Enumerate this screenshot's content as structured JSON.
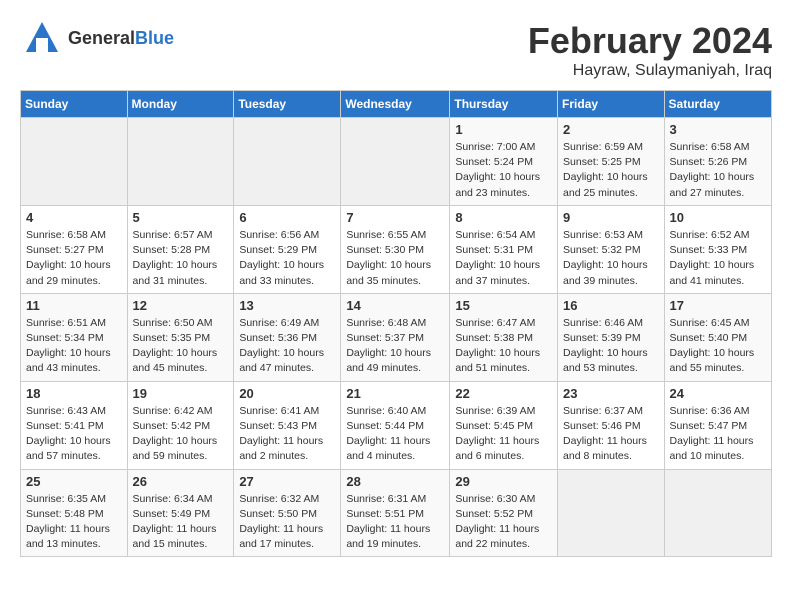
{
  "logo": {
    "general": "General",
    "blue": "Blue"
  },
  "title": "February 2024",
  "subtitle": "Hayraw, Sulaymaniyah, Iraq",
  "days_of_week": [
    "Sunday",
    "Monday",
    "Tuesday",
    "Wednesday",
    "Thursday",
    "Friday",
    "Saturday"
  ],
  "weeks": [
    [
      {
        "day": "",
        "detail": ""
      },
      {
        "day": "",
        "detail": ""
      },
      {
        "day": "",
        "detail": ""
      },
      {
        "day": "",
        "detail": ""
      },
      {
        "day": "1",
        "detail": "Sunrise: 7:00 AM\nSunset: 5:24 PM\nDaylight: 10 hours\nand 23 minutes."
      },
      {
        "day": "2",
        "detail": "Sunrise: 6:59 AM\nSunset: 5:25 PM\nDaylight: 10 hours\nand 25 minutes."
      },
      {
        "day": "3",
        "detail": "Sunrise: 6:58 AM\nSunset: 5:26 PM\nDaylight: 10 hours\nand 27 minutes."
      }
    ],
    [
      {
        "day": "4",
        "detail": "Sunrise: 6:58 AM\nSunset: 5:27 PM\nDaylight: 10 hours\nand 29 minutes."
      },
      {
        "day": "5",
        "detail": "Sunrise: 6:57 AM\nSunset: 5:28 PM\nDaylight: 10 hours\nand 31 minutes."
      },
      {
        "day": "6",
        "detail": "Sunrise: 6:56 AM\nSunset: 5:29 PM\nDaylight: 10 hours\nand 33 minutes."
      },
      {
        "day": "7",
        "detail": "Sunrise: 6:55 AM\nSunset: 5:30 PM\nDaylight: 10 hours\nand 35 minutes."
      },
      {
        "day": "8",
        "detail": "Sunrise: 6:54 AM\nSunset: 5:31 PM\nDaylight: 10 hours\nand 37 minutes."
      },
      {
        "day": "9",
        "detail": "Sunrise: 6:53 AM\nSunset: 5:32 PM\nDaylight: 10 hours\nand 39 minutes."
      },
      {
        "day": "10",
        "detail": "Sunrise: 6:52 AM\nSunset: 5:33 PM\nDaylight: 10 hours\nand 41 minutes."
      }
    ],
    [
      {
        "day": "11",
        "detail": "Sunrise: 6:51 AM\nSunset: 5:34 PM\nDaylight: 10 hours\nand 43 minutes."
      },
      {
        "day": "12",
        "detail": "Sunrise: 6:50 AM\nSunset: 5:35 PM\nDaylight: 10 hours\nand 45 minutes."
      },
      {
        "day": "13",
        "detail": "Sunrise: 6:49 AM\nSunset: 5:36 PM\nDaylight: 10 hours\nand 47 minutes."
      },
      {
        "day": "14",
        "detail": "Sunrise: 6:48 AM\nSunset: 5:37 PM\nDaylight: 10 hours\nand 49 minutes."
      },
      {
        "day": "15",
        "detail": "Sunrise: 6:47 AM\nSunset: 5:38 PM\nDaylight: 10 hours\nand 51 minutes."
      },
      {
        "day": "16",
        "detail": "Sunrise: 6:46 AM\nSunset: 5:39 PM\nDaylight: 10 hours\nand 53 minutes."
      },
      {
        "day": "17",
        "detail": "Sunrise: 6:45 AM\nSunset: 5:40 PM\nDaylight: 10 hours\nand 55 minutes."
      }
    ],
    [
      {
        "day": "18",
        "detail": "Sunrise: 6:43 AM\nSunset: 5:41 PM\nDaylight: 10 hours\nand 57 minutes."
      },
      {
        "day": "19",
        "detail": "Sunrise: 6:42 AM\nSunset: 5:42 PM\nDaylight: 10 hours\nand 59 minutes."
      },
      {
        "day": "20",
        "detail": "Sunrise: 6:41 AM\nSunset: 5:43 PM\nDaylight: 11 hours\nand 2 minutes."
      },
      {
        "day": "21",
        "detail": "Sunrise: 6:40 AM\nSunset: 5:44 PM\nDaylight: 11 hours\nand 4 minutes."
      },
      {
        "day": "22",
        "detail": "Sunrise: 6:39 AM\nSunset: 5:45 PM\nDaylight: 11 hours\nand 6 minutes."
      },
      {
        "day": "23",
        "detail": "Sunrise: 6:37 AM\nSunset: 5:46 PM\nDaylight: 11 hours\nand 8 minutes."
      },
      {
        "day": "24",
        "detail": "Sunrise: 6:36 AM\nSunset: 5:47 PM\nDaylight: 11 hours\nand 10 minutes."
      }
    ],
    [
      {
        "day": "25",
        "detail": "Sunrise: 6:35 AM\nSunset: 5:48 PM\nDaylight: 11 hours\nand 13 minutes."
      },
      {
        "day": "26",
        "detail": "Sunrise: 6:34 AM\nSunset: 5:49 PM\nDaylight: 11 hours\nand 15 minutes."
      },
      {
        "day": "27",
        "detail": "Sunrise: 6:32 AM\nSunset: 5:50 PM\nDaylight: 11 hours\nand 17 minutes."
      },
      {
        "day": "28",
        "detail": "Sunrise: 6:31 AM\nSunset: 5:51 PM\nDaylight: 11 hours\nand 19 minutes."
      },
      {
        "day": "29",
        "detail": "Sunrise: 6:30 AM\nSunset: 5:52 PM\nDaylight: 11 hours\nand 22 minutes."
      },
      {
        "day": "",
        "detail": ""
      },
      {
        "day": "",
        "detail": ""
      }
    ]
  ]
}
